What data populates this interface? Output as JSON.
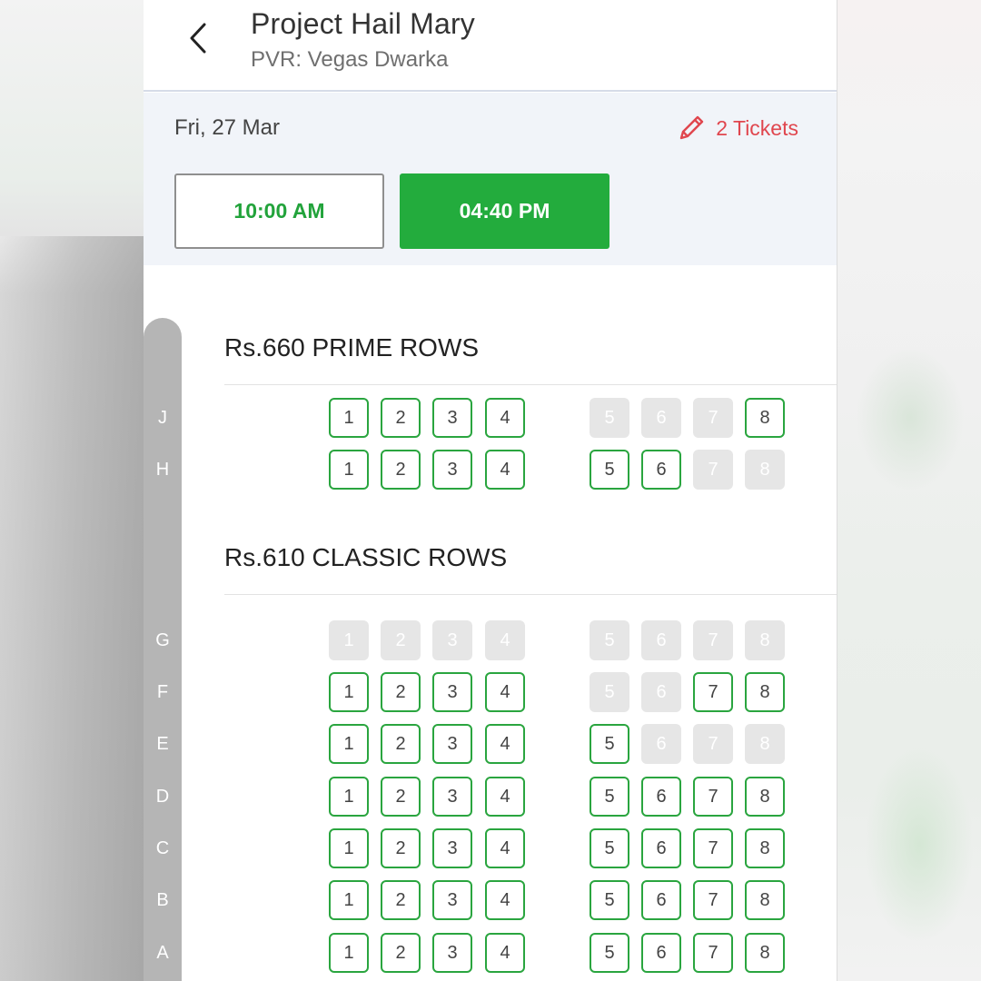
{
  "header": {
    "title": "Project Hail Mary",
    "subtitle": "PVR: Vegas Dwarka"
  },
  "showbar": {
    "date": "Fri, 27 Mar",
    "tickets_label": "2 Tickets",
    "showtimes": [
      {
        "label": "10:00 AM",
        "selected": false
      },
      {
        "label": "04:40 PM",
        "selected": true
      }
    ]
  },
  "colors": {
    "available_border": "#2aa53f",
    "selected_show": "#23ac3d",
    "sold_seat": "#e6e6e6",
    "accent_red": "#e0464e"
  },
  "sections": [
    {
      "title": "Rs.660  PRIME ROWS",
      "rows": [
        {
          "row": "J",
          "seats": [
            {
              "n": "1",
              "status": "available"
            },
            {
              "n": "2",
              "status": "available"
            },
            {
              "n": "3",
              "status": "available"
            },
            {
              "n": "4",
              "status": "available"
            },
            {
              "n": "5",
              "status": "sold"
            },
            {
              "n": "6",
              "status": "sold"
            },
            {
              "n": "7",
              "status": "sold"
            },
            {
              "n": "8",
              "status": "available"
            }
          ]
        },
        {
          "row": "H",
          "seats": [
            {
              "n": "1",
              "status": "available"
            },
            {
              "n": "2",
              "status": "available"
            },
            {
              "n": "3",
              "status": "available"
            },
            {
              "n": "4",
              "status": "available"
            },
            {
              "n": "5",
              "status": "available"
            },
            {
              "n": "6",
              "status": "available"
            },
            {
              "n": "7",
              "status": "sold"
            },
            {
              "n": "8",
              "status": "sold"
            }
          ]
        }
      ]
    },
    {
      "title": "Rs.610  CLASSIC ROWS",
      "rows": [
        {
          "row": "G",
          "seats": [
            {
              "n": "1",
              "status": "sold"
            },
            {
              "n": "2",
              "status": "sold"
            },
            {
              "n": "3",
              "status": "sold"
            },
            {
              "n": "4",
              "status": "sold"
            },
            {
              "n": "5",
              "status": "sold"
            },
            {
              "n": "6",
              "status": "sold"
            },
            {
              "n": "7",
              "status": "sold"
            },
            {
              "n": "8",
              "status": "sold"
            }
          ]
        },
        {
          "row": "F",
          "seats": [
            {
              "n": "1",
              "status": "available"
            },
            {
              "n": "2",
              "status": "available"
            },
            {
              "n": "3",
              "status": "available"
            },
            {
              "n": "4",
              "status": "available"
            },
            {
              "n": "5",
              "status": "sold"
            },
            {
              "n": "6",
              "status": "sold"
            },
            {
              "n": "7",
              "status": "available"
            },
            {
              "n": "8",
              "status": "available"
            }
          ]
        },
        {
          "row": "E",
          "seats": [
            {
              "n": "1",
              "status": "available"
            },
            {
              "n": "2",
              "status": "available"
            },
            {
              "n": "3",
              "status": "available"
            },
            {
              "n": "4",
              "status": "available"
            },
            {
              "n": "5",
              "status": "available"
            },
            {
              "n": "6",
              "status": "sold"
            },
            {
              "n": "7",
              "status": "sold"
            },
            {
              "n": "8",
              "status": "sold"
            }
          ]
        },
        {
          "row": "D",
          "seats": [
            {
              "n": "1",
              "status": "available"
            },
            {
              "n": "2",
              "status": "available"
            },
            {
              "n": "3",
              "status": "available"
            },
            {
              "n": "4",
              "status": "available"
            },
            {
              "n": "5",
              "status": "available"
            },
            {
              "n": "6",
              "status": "available"
            },
            {
              "n": "7",
              "status": "available"
            },
            {
              "n": "8",
              "status": "available"
            }
          ]
        },
        {
          "row": "C",
          "seats": [
            {
              "n": "1",
              "status": "available"
            },
            {
              "n": "2",
              "status": "available"
            },
            {
              "n": "3",
              "status": "available"
            },
            {
              "n": "4",
              "status": "available"
            },
            {
              "n": "5",
              "status": "available"
            },
            {
              "n": "6",
              "status": "available"
            },
            {
              "n": "7",
              "status": "available"
            },
            {
              "n": "8",
              "status": "available"
            }
          ]
        },
        {
          "row": "B",
          "seats": [
            {
              "n": "1",
              "status": "available"
            },
            {
              "n": "2",
              "status": "available"
            },
            {
              "n": "3",
              "status": "available"
            },
            {
              "n": "4",
              "status": "available"
            },
            {
              "n": "5",
              "status": "available"
            },
            {
              "n": "6",
              "status": "available"
            },
            {
              "n": "7",
              "status": "available"
            },
            {
              "n": "8",
              "status": "available"
            }
          ]
        },
        {
          "row": "A",
          "seats": [
            {
              "n": "1",
              "status": "available"
            },
            {
              "n": "2",
              "status": "available"
            },
            {
              "n": "3",
              "status": "available"
            },
            {
              "n": "4",
              "status": "available"
            },
            {
              "n": "5",
              "status": "available"
            },
            {
              "n": "6",
              "status": "available"
            },
            {
              "n": "7",
              "status": "available"
            },
            {
              "n": "8",
              "status": "available"
            }
          ]
        }
      ]
    }
  ]
}
